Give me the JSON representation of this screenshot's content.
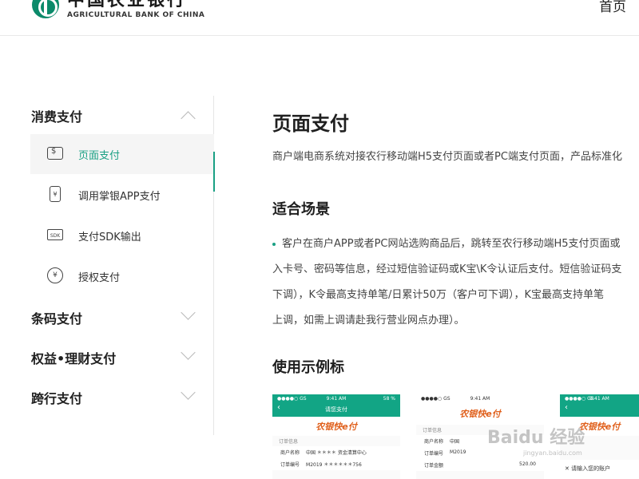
{
  "header": {
    "logo_cn": "中国农业银行",
    "logo_en": "AGRICULTURAL BANK OF CHINA",
    "nav_home": "首页"
  },
  "sidebar": {
    "categories": [
      {
        "label": "消费支付",
        "expanded": true
      },
      {
        "label": "条码支付",
        "expanded": false
      },
      {
        "label": "权益•理财支付",
        "expanded": false
      },
      {
        "label": "跨行支付",
        "expanded": false
      }
    ],
    "items": [
      {
        "label": "页面支付",
        "icon": "payment-page-icon",
        "active": true
      },
      {
        "label": "调用掌银APP支付",
        "icon": "mobile-app-icon",
        "active": false
      },
      {
        "label": "支付SDK输出",
        "icon": "sdk-icon",
        "active": false
      },
      {
        "label": "授权支付",
        "icon": "hand-coin-icon",
        "active": false
      }
    ]
  },
  "main": {
    "title": "页面支付",
    "description": "商户端电商系统对接农行移动端H5支付页面或者PC端支付页面，产品标准化",
    "scene_title": "适合场景",
    "scene_lines": [
      "客户在商户APP或者PC网站选购商品后，跳转至农行移动端H5支付页面或",
      "入卡号、密码等信息，经过短信验证码或K宝\\K令认证后支付。短信验证码支",
      "下调），K令最高支持单笔/日累计50万（客户可下调），K宝最高支持单笔",
      "上调，如需上调请赴我行营业网点办理）。"
    ],
    "example_title": "使用示例标"
  },
  "mockups": [
    {
      "status": "●●●●○ GS",
      "time": "9:41 AM",
      "battery": "58 %",
      "title": "请您支付",
      "brand": "农银快e付",
      "section": "订单信息",
      "rows": [
        [
          "商户名称",
          "中国 ＊＊＊＊ 资金清算中心"
        ],
        [
          "订单编号",
          "M2019 ＊＊＊＊＊＊756"
        ]
      ]
    },
    {
      "status": "●●●●○ GS",
      "time": "9:41 AM",
      "battery": "",
      "title": "",
      "brand": "农银快e付",
      "section": "订单信息",
      "rows": [
        [
          "商户名称",
          "中国"
        ],
        [
          "订单编号",
          "M2019"
        ],
        [
          "订单金额",
          "520.00"
        ]
      ]
    },
    {
      "status": "●●●●○ GS",
      "time": "9:41 AM",
      "battery": "",
      "title": "请输入您的账户",
      "brand": "农银快e付",
      "section": "",
      "rows": []
    }
  ],
  "watermark": {
    "text": "Baidu 经验",
    "sub": "jingyan.baidu.com"
  }
}
